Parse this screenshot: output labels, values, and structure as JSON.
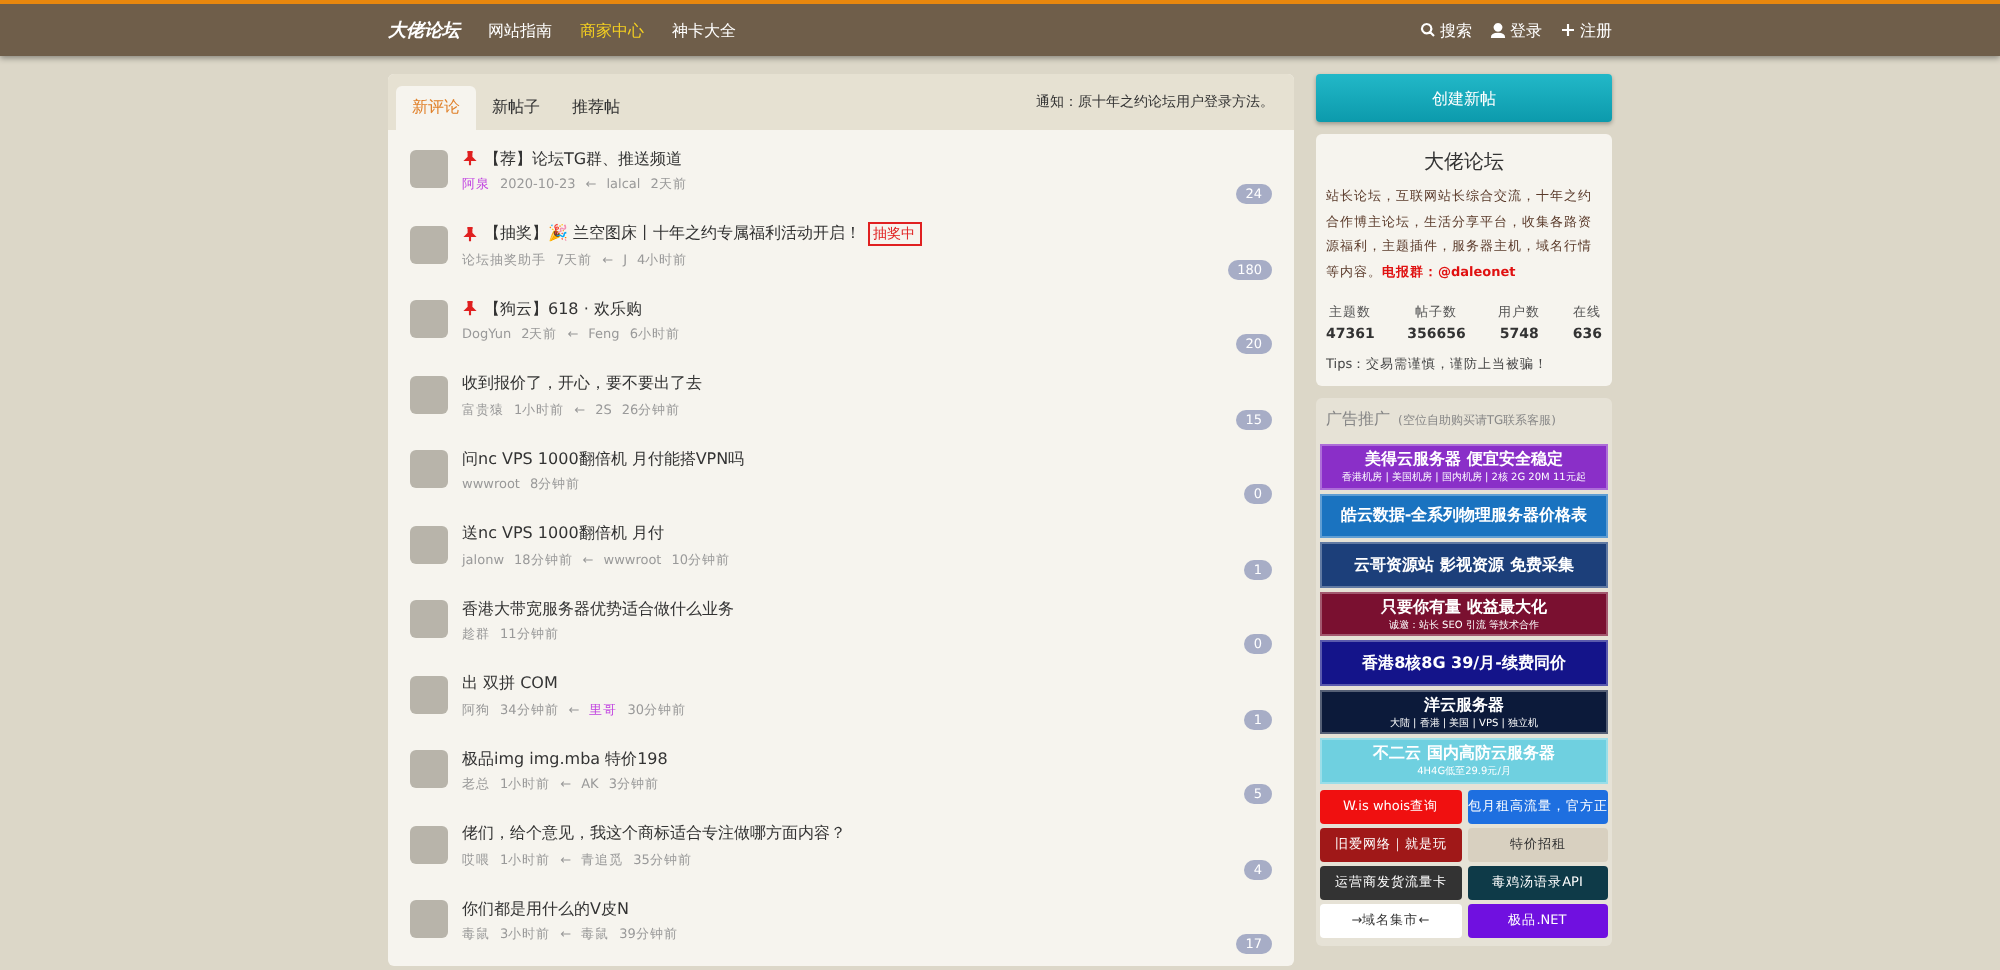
{
  "nav": {
    "logo": "大佬论坛",
    "links": [
      {
        "label": "网站指南",
        "selected": false
      },
      {
        "label": "商家中心",
        "selected": true
      },
      {
        "label": "神卡大全",
        "selected": false
      }
    ],
    "actions": [
      {
        "kind": "search",
        "label": "搜索"
      },
      {
        "kind": "user",
        "label": "登录"
      },
      {
        "kind": "plus",
        "label": "注册"
      }
    ]
  },
  "tabs": [
    {
      "label": "新评论",
      "selected": true
    },
    {
      "label": "新帖子",
      "selected": false
    },
    {
      "label": "推荐帖",
      "selected": false
    }
  ],
  "notice": "通知：原十年之约论坛用户登录方法。",
  "topics": [
    {
      "pinned": true,
      "title": "【荐】论坛TG群、推送频道",
      "author": "阿泉",
      "author_extra": {
        "color": "#c040e0"
      },
      "time": "2020-10-23",
      "arrow": "←",
      "last_replier": "lalcal",
      "last_time": "2天前",
      "replies": "24"
    },
    {
      "pinned": true,
      "title": "【抽奖】🎉 兰空图床丨十年之约专属福利活动开启！",
      "tag": "抽奖中",
      "author": "论坛抽奖助手",
      "time": "7天前",
      "arrow": "←",
      "last_replier": "J",
      "last_time": "4小时前",
      "replies": "180"
    },
    {
      "pinned": true,
      "title": "【狗云】618 · 欢乐购",
      "author": "DogYun",
      "time": "2天前",
      "arrow": "←",
      "last_replier": "Feng",
      "last_time": "6小时前",
      "replies": "20"
    },
    {
      "pinned": false,
      "title": "收到报价了，开心，要不要出了去",
      "author": "富贵猿",
      "time": "1小时前",
      "arrow": "←",
      "last_replier": "2S",
      "last_time": "26分钟前",
      "replies": "15"
    },
    {
      "pinned": false,
      "title": "问nc VPS 1000翻倍机 月付能搭VPN吗",
      "author": "wwwroot",
      "time": "8分钟前",
      "replies": "0"
    },
    {
      "pinned": false,
      "title": "送nc VPS 1000翻倍机 月付",
      "author": "jalonw",
      "time": "18分钟前",
      "arrow": "←",
      "last_replier": "wwwroot",
      "last_time": "10分钟前",
      "replies": "1"
    },
    {
      "pinned": false,
      "title": "香港大带宽服务器优势适合做什么业务",
      "author": "趁群",
      "time": "11分钟前",
      "replies": "0"
    },
    {
      "pinned": false,
      "title": "出 双拼 COM",
      "author": "阿狗",
      "time": "34分钟前",
      "arrow": "←",
      "last_replier": "里哥",
      "last_extra": {
        "color": "#c040e0"
      },
      "last_time": "30分钟前",
      "replies": "1"
    },
    {
      "pinned": false,
      "title": "极品img img.mba 特价198",
      "author": "老总",
      "time": "1小时前",
      "arrow": "←",
      "last_replier": "AK",
      "last_time": "3分钟前",
      "replies": "5"
    },
    {
      "pinned": false,
      "title": "佬们，给个意见，我这个商标适合专注做哪方面内容？",
      "author": "哎喂",
      "time": "1小时前",
      "arrow": "←",
      "last_replier": "青追觅",
      "last_time": "35分钟前",
      "replies": "4"
    },
    {
      "pinned": false,
      "title": "你们都是用什么的V皮N",
      "author": "毒鼠",
      "time": "3小时前",
      "arrow": "←",
      "last_replier": "毒鼠",
      "last_time": "39分钟前",
      "replies": "17"
    }
  ],
  "sidebar": {
    "create_button": "创建新帖",
    "about": {
      "title": "大佬论坛",
      "description": "站长论坛，互联网站长综合交流，十年之约合作博主论坛，生活分享平台，收集各路资源福利，主题插件，服务器主机，域名行情等内容。",
      "contact": "电报群：@daleonet",
      "stats": [
        {
          "label": "主题数",
          "value": "47361"
        },
        {
          "label": "帖子数",
          "value": "356656"
        },
        {
          "label": "用户数",
          "value": "5748"
        },
        {
          "label": "在线",
          "value": "636"
        }
      ],
      "tips": "Tips：交易需谨慎，谨防上当被骗！"
    },
    "ads": {
      "title": "广告推广",
      "note": "(空位自助购买请TG联系客服)",
      "banners": [
        {
          "lines": [
            "美得云服务器 便宜安全稳定",
            "香港机房 | 美国机房 | 国内机房 | 2核 2G 20M 11元起"
          ],
          "color": "#8a2fc8"
        },
        {
          "lines": [
            "皓云数据-全系列物理服务器价格表"
          ],
          "color": "#1a73c0"
        },
        {
          "lines": [
            "云哥资源站 影视资源 免费采集"
          ],
          "color": "#1c3f7a"
        },
        {
          "lines": [
            "只要你有量 收益最大化",
            "诚邀：站长 SEO 引流 等技术合作"
          ],
          "color": "#7a1030"
        },
        {
          "lines": [
            "香港8核8G 39/月-续费同价"
          ],
          "color": "#14148a"
        },
        {
          "lines": [
            "洋云服务器",
            "大陆 | 香港 | 美国 | VPS | 独立机"
          ],
          "color": "#0c1a3a"
        },
        {
          "lines": [
            "不二云 国内高防云服务器",
            "4H4G低至29.9元/月"
          ],
          "color": "#6fd0e0"
        }
      ],
      "links": [
        {
          "label": "W.is whois查询",
          "color": "#f01010"
        },
        {
          "label": "包月租高流量，官方正",
          "color": "#1e6fe0"
        },
        {
          "label": "旧爱网络｜就是玩",
          "color": "#a01818"
        },
        {
          "label": "特价招租",
          "color": "#d8d0c0"
        },
        {
          "label": "运营商发货流量卡",
          "color": "#333333"
        },
        {
          "label": "毒鸡汤语录API",
          "color": "#0e3a48"
        },
        {
          "label": "→域名集市←",
          "color": "#ffffff"
        },
        {
          "label": "极品.NET",
          "color": "#7010e0"
        }
      ]
    }
  }
}
